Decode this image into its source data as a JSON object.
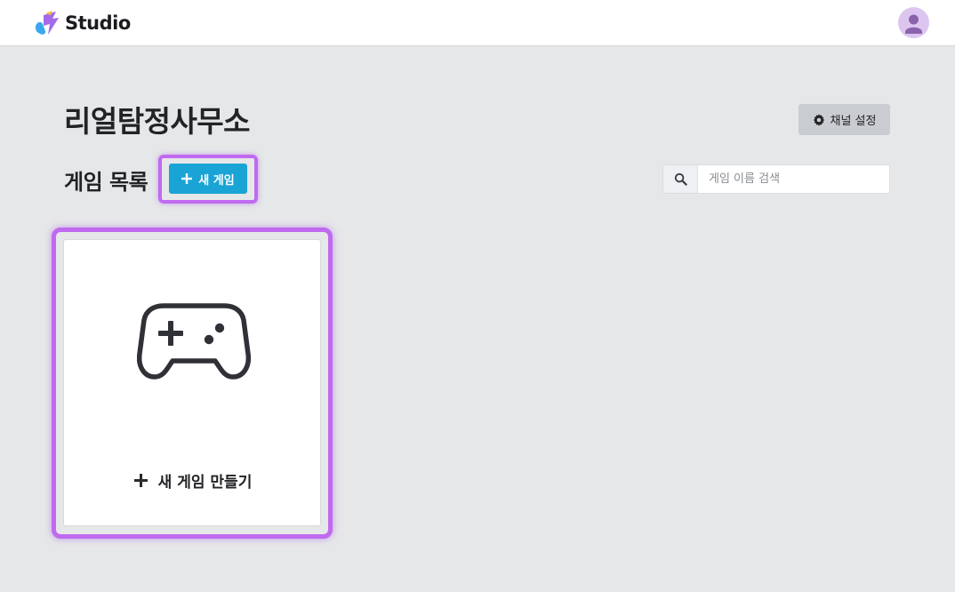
{
  "header": {
    "logo_text": "Studio",
    "logo_icon": "studio-logo-icon",
    "avatar_icon": "user-avatar-icon"
  },
  "channel": {
    "title": "리얼탐정사무소",
    "settings_label": "채널 설정",
    "settings_icon": "gear-icon"
  },
  "games": {
    "section_title": "게임 목록",
    "new_button_label": "새 게임",
    "new_button_icon": "plus-icon",
    "search": {
      "placeholder": "게임 이름 검색",
      "value": "",
      "icon": "search-icon"
    },
    "new_card": {
      "label": "새 게임 만들기",
      "icon": "gamepad-icon"
    }
  },
  "colors": {
    "accent": "#1aa4d6",
    "highlight": "#c06af0",
    "background": "#e6e7e9"
  }
}
